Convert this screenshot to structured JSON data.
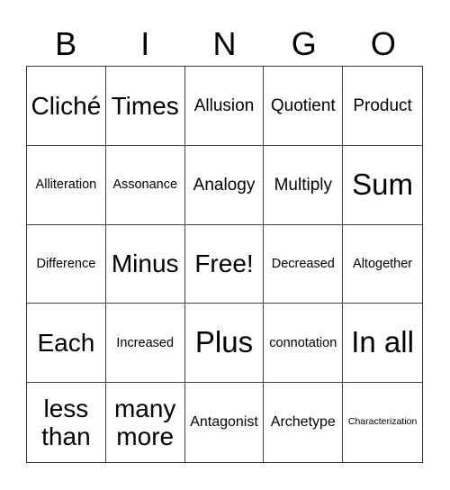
{
  "header": [
    "B",
    "I",
    "N",
    "G",
    "O"
  ],
  "cells": [
    {
      "text": "Cliché",
      "size": "l"
    },
    {
      "text": "Times",
      "size": "l"
    },
    {
      "text": "Allusion",
      "size": "m"
    },
    {
      "text": "Quotient",
      "size": "m"
    },
    {
      "text": "Product",
      "size": "m"
    },
    {
      "text": "Alliteration",
      "size": "xs"
    },
    {
      "text": "Assonance",
      "size": "xs"
    },
    {
      "text": "Analogy",
      "size": "m"
    },
    {
      "text": "Multiply",
      "size": "m"
    },
    {
      "text": "Sum",
      "size": "xl"
    },
    {
      "text": "Difference",
      "size": "xs"
    },
    {
      "text": "Minus",
      "size": "l"
    },
    {
      "text": "Free!",
      "size": "l"
    },
    {
      "text": "Decreased",
      "size": "xs"
    },
    {
      "text": "Altogether",
      "size": "xs"
    },
    {
      "text": "Each",
      "size": "l"
    },
    {
      "text": "Increased",
      "size": "xs"
    },
    {
      "text": "Plus",
      "size": "xl"
    },
    {
      "text": "connotation",
      "size": "xs"
    },
    {
      "text": "In all",
      "size": "xl"
    },
    {
      "text": "less than",
      "size": "l"
    },
    {
      "text": "many more",
      "size": "l"
    },
    {
      "text": "Antagonist",
      "size": "s"
    },
    {
      "text": "Archetype",
      "size": "s"
    },
    {
      "text": "Characterization",
      "size": "xxs"
    }
  ]
}
